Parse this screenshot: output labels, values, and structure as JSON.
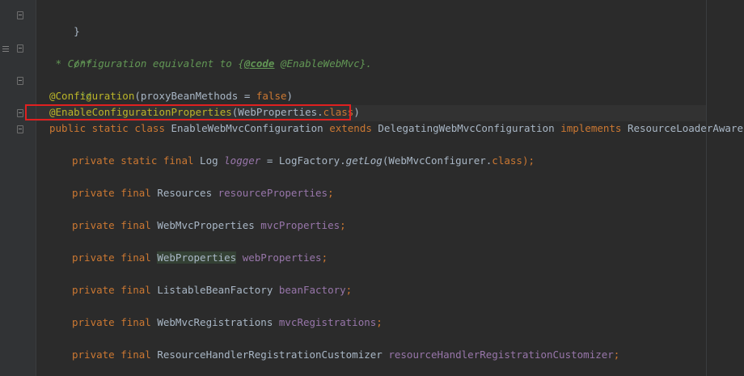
{
  "code_lines": {
    "l1": "}",
    "l2_open": "/**",
    "l3_pre": " * Configuration equivalent to {",
    "l3_tag": "@code",
    "l3_post": " @EnableWebMvc}.",
    "l4": " */",
    "l5_ann": "@Configuration",
    "l5_paren": "(proxyBeanMethods = ",
    "l5_false": "false",
    "l5_close": ")",
    "l6_ann": "@EnableConfigurationProperties",
    "l6_paren": "(WebProperties.",
    "l6_class": "class",
    "l6_close": ")",
    "l7_kw1": "public static class ",
    "l7_name": "EnableWebMvcConfiguration ",
    "l7_kw2": "extends ",
    "l7_super": "DelegatingWebMvcConfiguration ",
    "l7_kw3": "implements ",
    "l7_iface": "ResourceLoaderAware {",
    "l8_kw": "private static final ",
    "l8_type": "Log ",
    "l8_field": "logger",
    "l8_eq": " = LogFactory.",
    "l8_method": "getLog",
    "l8_arg": "(WebMvcConfigurer.",
    "l8_class": "class",
    "l8_end": ");",
    "l9_kw": "private final ",
    "l9_type": "Resources ",
    "l9_field": "resourceProperties",
    "l10_kw": "private final ",
    "l10_type": "WebMvcProperties ",
    "l10_field": "mvcProperties",
    "l11_kw": "private final ",
    "l11_type": "WebProperties",
    "l11_field": "webProperties",
    "l12_kw": "private final ",
    "l12_type": "ListableBeanFactory ",
    "l12_field": "beanFactory",
    "l13_kw": "private final ",
    "l13_type": "WebMvcRegistrations ",
    "l13_field": "mvcRegistrations",
    "l14_kw": "private final ",
    "l14_type": "ResourceHandlerRegistrationCustomizer ",
    "l14_field": "resourceHandlerRegistrationCustomizer",
    "semicolon": ";"
  },
  "icons": {
    "fold": "fold-marker-icon",
    "doc": "javadoc-render-icon"
  },
  "colors": {
    "background": "#2b2b2b",
    "gutter": "#313335",
    "keyword": "#cc7832",
    "annotation": "#bbb529",
    "comment": "#629755",
    "field": "#9876aa",
    "highlight_box": "#e02020"
  }
}
